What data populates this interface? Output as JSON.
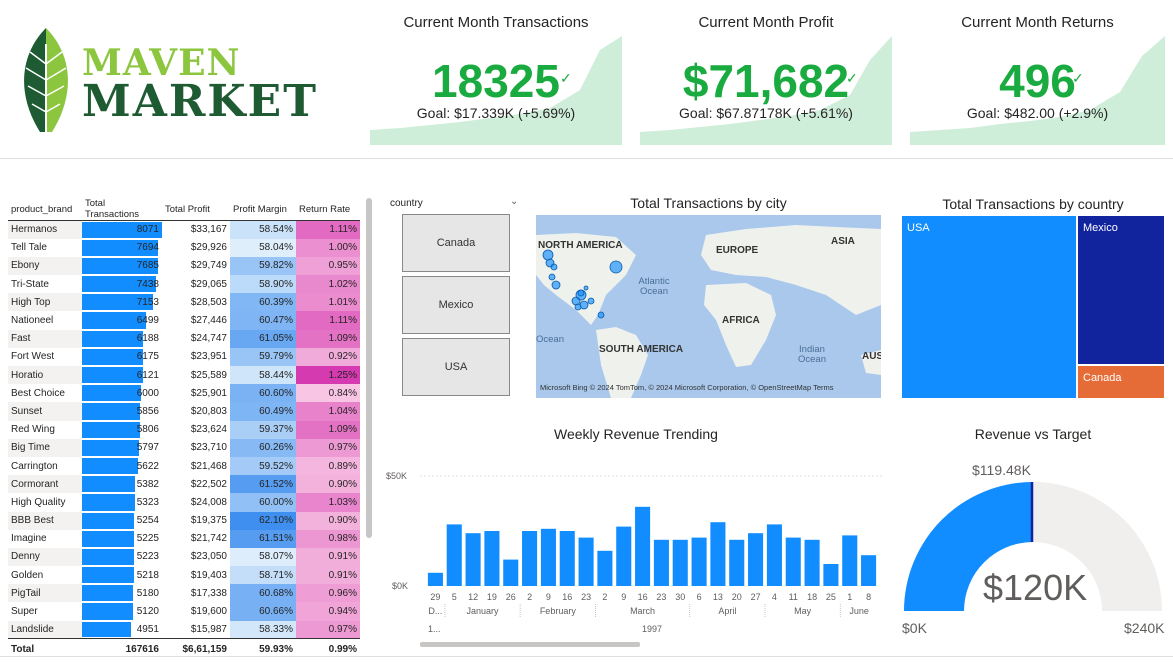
{
  "brand": {
    "line1": "MAVEN",
    "line2": "MARKET"
  },
  "kpis": [
    {
      "title": "Current Month Transactions",
      "value": "18325",
      "goal": "Goal: $17.339K (+5.69%)"
    },
    {
      "title": "Current Month Profit",
      "value": "$71,682",
      "goal": "Goal: $67.87178K (+5.61%)"
    },
    {
      "title": "Current Month Returns",
      "value": "496",
      "goal": "Goal: $482.00 (+2.9%)"
    }
  ],
  "table": {
    "headers": [
      "product_brand",
      "Total Transactions",
      "Total Profit",
      "Profit Margin",
      "Return Rate"
    ],
    "rows": [
      [
        "Hermanos",
        "8071",
        "$33,167",
        "58.54%",
        "1.11%"
      ],
      [
        "Tell Tale",
        "7694",
        "$29,926",
        "58.04%",
        "1.00%"
      ],
      [
        "Ebony",
        "7685",
        "$29,749",
        "59.82%",
        "0.95%"
      ],
      [
        "Tri-State",
        "7438",
        "$29,065",
        "58.90%",
        "1.02%"
      ],
      [
        "High Top",
        "7153",
        "$28,503",
        "60.39%",
        "1.01%"
      ],
      [
        "Nationeel",
        "6499",
        "$27,446",
        "60.47%",
        "1.11%"
      ],
      [
        "Fast",
        "6188",
        "$24,747",
        "61.05%",
        "1.09%"
      ],
      [
        "Fort West",
        "6175",
        "$23,951",
        "59.79%",
        "0.92%"
      ],
      [
        "Horatio",
        "6121",
        "$25,589",
        "58.44%",
        "1.25%"
      ],
      [
        "Best Choice",
        "6000",
        "$25,901",
        "60.60%",
        "0.84%"
      ],
      [
        "Sunset",
        "5856",
        "$20,803",
        "60.49%",
        "1.04%"
      ],
      [
        "Red Wing",
        "5806",
        "$23,624",
        "59.37%",
        "1.09%"
      ],
      [
        "Big Time",
        "5797",
        "$23,710",
        "60.26%",
        "0.97%"
      ],
      [
        "Carrington",
        "5622",
        "$21,468",
        "59.52%",
        "0.89%"
      ],
      [
        "Cormorant",
        "5382",
        "$22,502",
        "61.52%",
        "0.90%"
      ],
      [
        "High Quality",
        "5323",
        "$24,008",
        "60.00%",
        "1.03%"
      ],
      [
        "BBB Best",
        "5254",
        "$19,375",
        "62.10%",
        "0.90%"
      ],
      [
        "Imagine",
        "5225",
        "$21,742",
        "61.51%",
        "0.98%"
      ],
      [
        "Denny",
        "5223",
        "$23,050",
        "58.07%",
        "0.91%"
      ],
      [
        "Golden",
        "5218",
        "$19,403",
        "58.71%",
        "0.91%"
      ],
      [
        "PigTail",
        "5180",
        "$17,338",
        "60.68%",
        "0.96%"
      ],
      [
        "Super",
        "5120",
        "$19,600",
        "60.66%",
        "0.94%"
      ],
      [
        "Landslide",
        "4951",
        "$15,987",
        "58.33%",
        "0.97%"
      ]
    ],
    "total": [
      "Total",
      "167616",
      "$6,61,159",
      "59.93%",
      "0.99%"
    ]
  },
  "slicer": {
    "title": "country",
    "options": [
      "Canada",
      "Mexico",
      "USA"
    ]
  },
  "map": {
    "title": "Total Transactions by city",
    "continents": [
      "NORTH AMERICA",
      "EUROPE",
      "ASIA",
      "AFRICA",
      "SOUTH AMERICA",
      "AUS"
    ],
    "oceans": [
      "Atlantic Ocean",
      "Indian Ocean",
      "Ocean"
    ],
    "footer": "Microsoft Bing  © 2024 TomTom, © 2024 Microsoft Corporation, © OpenStreetMap  Terms"
  },
  "treemap": {
    "title": "Total Transactions by country",
    "labels": [
      "USA",
      "Mexico",
      "Canada"
    ]
  },
  "weekly": {
    "title": "Weekly Revenue Trending",
    "y_ticks": [
      "$50K",
      "$0K"
    ],
    "days": [
      "29",
      "5",
      "12",
      "19",
      "26",
      "2",
      "9",
      "16",
      "23",
      "2",
      "9",
      "16",
      "23",
      "30",
      "6",
      "13",
      "20",
      "27",
      "4",
      "11",
      "18",
      "25",
      "1",
      "8"
    ],
    "months": [
      "D...",
      "January",
      "February",
      "March",
      "April",
      "May",
      "June"
    ],
    "quarter": "1...",
    "year": "1997"
  },
  "gauge": {
    "title": "Revenue vs Target",
    "target_label": "$119.48K",
    "value": "$120K",
    "min": "$0K",
    "max": "$240K"
  },
  "chart_data": {
    "type": "bar",
    "title": "Weekly Revenue Trending",
    "categories": [
      "Dec 29",
      "Jan 5",
      "Jan 12",
      "Jan 19",
      "Jan 26",
      "Feb 2",
      "Feb 9",
      "Feb 16",
      "Feb 23",
      "Mar 2",
      "Mar 9",
      "Mar 16",
      "Mar 23",
      "Mar 30",
      "Apr 6",
      "Apr 13",
      "Apr 20",
      "Apr 27",
      "May 4",
      "May 11",
      "May 18",
      "May 25",
      "Jun 1",
      "Jun 8"
    ],
    "values": [
      6,
      28,
      24,
      25,
      12,
      25,
      26,
      25,
      22,
      16,
      27,
      36,
      21,
      21,
      22,
      29,
      21,
      24,
      28,
      22,
      21,
      10,
      23,
      14
    ],
    "ylabel": "",
    "ylim": [
      0,
      50
    ],
    "y_unit": "$K"
  },
  "colors": {
    "accent": "#118dff",
    "kpi_green": "#1aab40",
    "tm_usa": "#118dff",
    "tm_mexico": "#12239e",
    "tm_canada": "#e66c37"
  }
}
